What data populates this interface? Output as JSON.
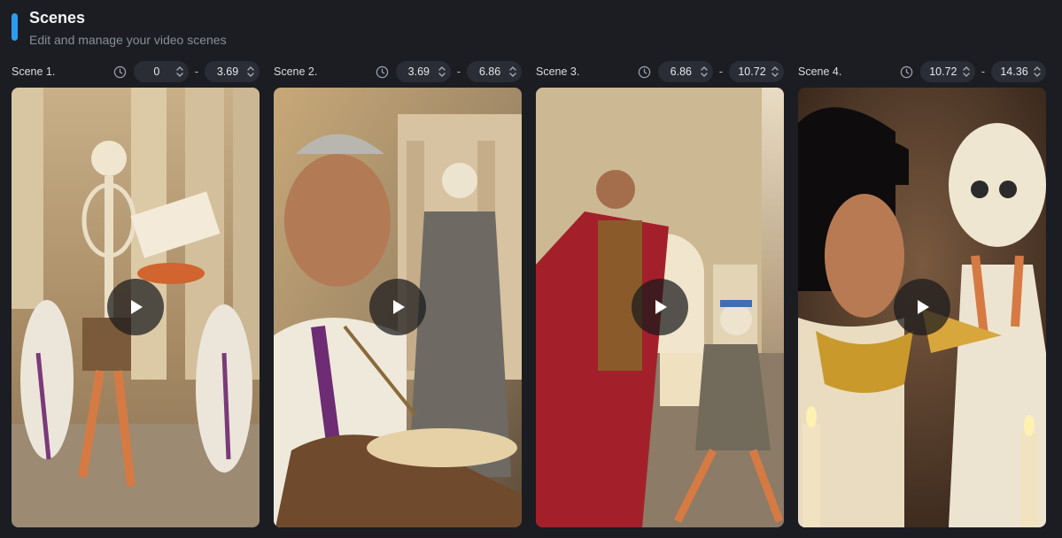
{
  "header": {
    "title": "Scenes",
    "subtitle": "Edit and manage your video scenes",
    "accent_color": "#2f9bf0"
  },
  "scenes": [
    {
      "label": "Scene 1.",
      "start": "0",
      "end": "3.69"
    },
    {
      "label": "Scene 2.",
      "start": "3.69",
      "end": "6.86"
    },
    {
      "label": "Scene 3.",
      "start": "6.86",
      "end": "10.72"
    },
    {
      "label": "Scene 4.",
      "start": "10.72",
      "end": "14.36"
    }
  ],
  "icons": {
    "clock": "clock-icon",
    "spinner": "chevron-up-down-icon",
    "play": "play-icon"
  }
}
